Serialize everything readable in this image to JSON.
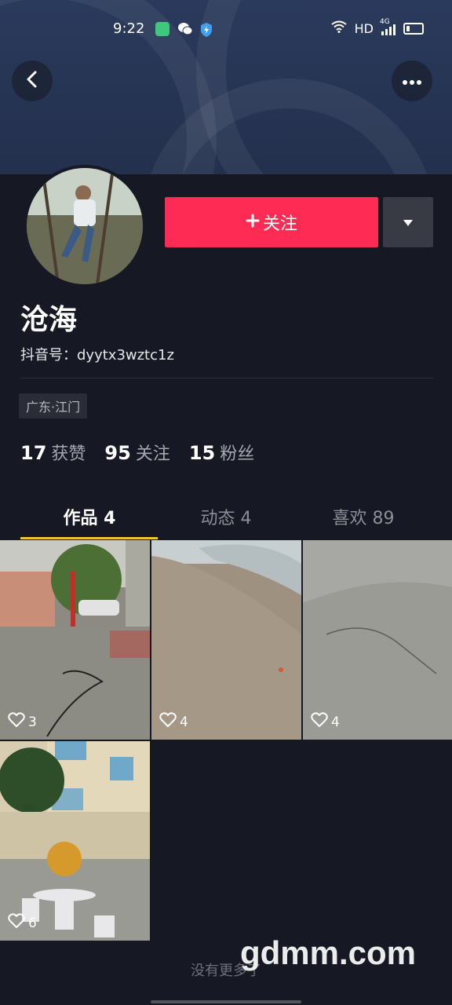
{
  "status_bar": {
    "time": "9:22",
    "network": "HD",
    "signal": "4G"
  },
  "header": {
    "back_icon": "back-arrow-icon",
    "more_icon": "more-dots-icon"
  },
  "profile": {
    "name": "沧海",
    "douyin_id": "抖音号：dyytx3wztc1z",
    "location": "广东·江门",
    "follow_label": "关注",
    "follow_icon": "plus-icon"
  },
  "stats": [
    {
      "value": "17",
      "label": "获赞"
    },
    {
      "value": "95",
      "label": "关注"
    },
    {
      "value": "15",
      "label": "粉丝"
    }
  ],
  "tabs": [
    {
      "label": "作品 4",
      "active": true
    },
    {
      "label": "动态 4",
      "active": false
    },
    {
      "label": "喜欢 89",
      "active": false
    }
  ],
  "videos": [
    {
      "likes": "3"
    },
    {
      "likes": "4"
    },
    {
      "likes": "4"
    },
    {
      "likes": "6"
    }
  ],
  "footer": {
    "no_more": "没有更多了",
    "watermark": "gdmm.com"
  },
  "colors": {
    "background": "#161823",
    "follow_button": "#fe2c55",
    "tab_indicator": "#f4c330"
  }
}
